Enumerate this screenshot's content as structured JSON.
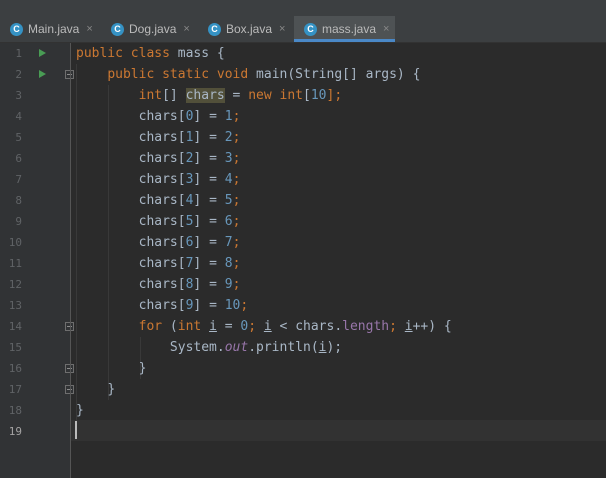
{
  "tabs": [
    {
      "label": "Main.java",
      "icon": "java-class-icon",
      "icon_letter": "C",
      "active": false
    },
    {
      "label": "Dog.java",
      "icon": "java-class-icon",
      "icon_letter": "C",
      "active": false
    },
    {
      "label": "Box.java",
      "icon": "java-class-icon",
      "icon_letter": "C",
      "active": false
    },
    {
      "label": "mass.java",
      "icon": "java-class-icon",
      "icon_letter": "C",
      "active": true
    }
  ],
  "tab_close_glyph": "×",
  "line_numbers": [
    "1",
    "2",
    "3",
    "4",
    "5",
    "6",
    "7",
    "8",
    "9",
    "10",
    "11",
    "12",
    "13",
    "14",
    "15",
    "16",
    "17",
    "18",
    "19"
  ],
  "current_line": "19",
  "code": {
    "l1": {
      "k1": "public",
      "k2": "class",
      "name": "mass",
      "brace": "{"
    },
    "l2": {
      "k1": "public",
      "k2": "static",
      "k3": "void",
      "rest": "main(String[] args) {"
    },
    "l3": {
      "type": "int",
      "a": "[] ",
      "var": "chars",
      "b": " = ",
      "kw": "new",
      "c": " ",
      "type2": "int",
      "d": "[",
      "n": "10",
      "e": "];"
    },
    "assign": [
      {
        "idx": "0",
        "val": "1"
      },
      {
        "idx": "1",
        "val": "2"
      },
      {
        "idx": "2",
        "val": "3"
      },
      {
        "idx": "3",
        "val": "4"
      },
      {
        "idx": "4",
        "val": "5"
      },
      {
        "idx": "5",
        "val": "6"
      },
      {
        "idx": "6",
        "val": "7"
      },
      {
        "idx": "7",
        "val": "8"
      },
      {
        "idx": "8",
        "val": "9"
      },
      {
        "idx": "9",
        "val": "10"
      }
    ],
    "assign_var": "chars",
    "l14": {
      "for": "for",
      "int": "int",
      "i": "i",
      "zero": "0",
      "chars": "chars",
      "length": "length"
    },
    "l15": {
      "system": "System.",
      "out": "out",
      "println": ".println(",
      "i": "i",
      "end": ");"
    },
    "l16": "}",
    "l17": "}",
    "l18": "}"
  },
  "colors": {
    "keyword": "#cc7832",
    "number": "#6897bb",
    "field": "#9876aa",
    "text": "#a9b7c6",
    "tab_underline": "#4a88c7"
  }
}
